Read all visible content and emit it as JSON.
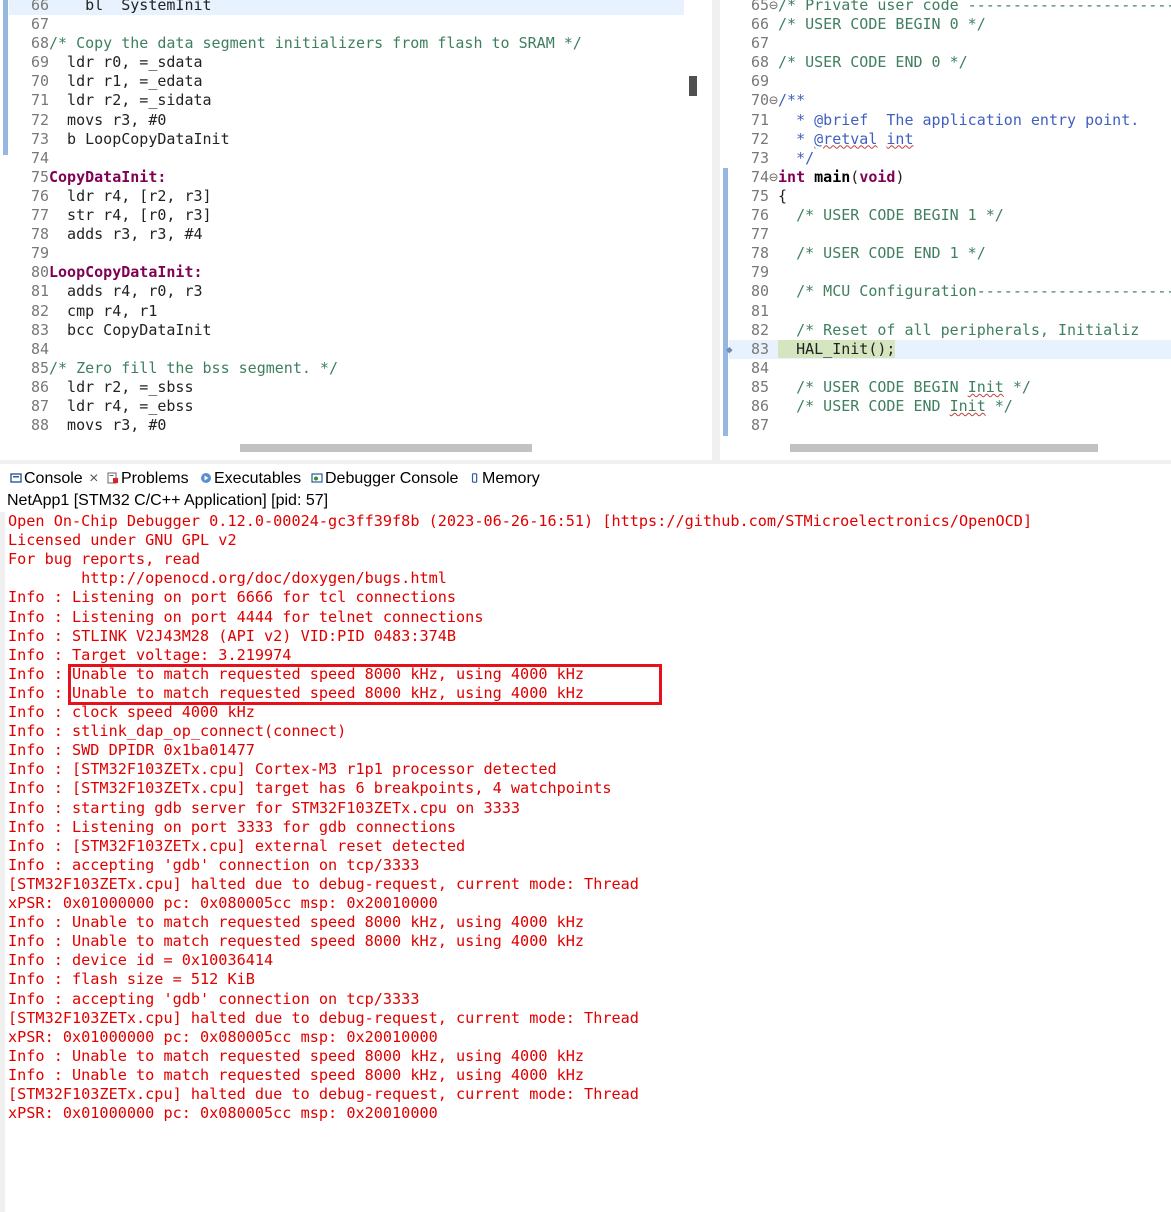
{
  "editor_left": {
    "lines": [
      {
        "n": "66",
        "code": "    bl  SystemInit"
      },
      {
        "n": "67",
        "code": ""
      },
      {
        "n": "68",
        "comment": "/* Copy the data segment initializers from flash to SRAM */"
      },
      {
        "n": "69",
        "code": "  ldr r0, =_sdata"
      },
      {
        "n": "70",
        "code": "  ldr r1, =_edata"
      },
      {
        "n": "71",
        "code": "  ldr r2, =_sidata"
      },
      {
        "n": "72",
        "code": "  movs r3, #0"
      },
      {
        "n": "73",
        "code": "  b LoopCopyDataInit"
      },
      {
        "n": "74",
        "code": ""
      },
      {
        "n": "75",
        "label": "CopyDataInit:"
      },
      {
        "n": "76",
        "code": "  ldr r4, [r2, r3]"
      },
      {
        "n": "77",
        "code": "  str r4, [r0, r3]"
      },
      {
        "n": "78",
        "code": "  adds r3, r3, #4"
      },
      {
        "n": "79",
        "code": ""
      },
      {
        "n": "80",
        "label": "LoopCopyDataInit:"
      },
      {
        "n": "81",
        "code": "  adds r4, r0, r3"
      },
      {
        "n": "82",
        "code": "  cmp r4, r1"
      },
      {
        "n": "83",
        "code": "  bcc CopyDataInit"
      },
      {
        "n": "84",
        "code": ""
      },
      {
        "n": "85",
        "comment": "/* Zero fill the bss segment. */"
      },
      {
        "n": "86",
        "code": "  ldr r2, =_sbss"
      },
      {
        "n": "87",
        "code": "  ldr r4, =_ebss"
      },
      {
        "n": "88",
        "code": "  movs r3, #0"
      }
    ]
  },
  "editor_right": {
    "l65": {
      "n": "65",
      "fold": "⊖",
      "comment": "/* Private user code -------------------------"
    },
    "l66": {
      "n": "66",
      "comment": "/* USER CODE BEGIN 0 */"
    },
    "l67": {
      "n": "67"
    },
    "l68": {
      "n": "68",
      "comment": "/* USER CODE END 0 */"
    },
    "l69": {
      "n": "69"
    },
    "l70": {
      "n": "70",
      "fold": "⊖",
      "comment": "/**"
    },
    "l71": {
      "n": "71",
      "pre": "  * ",
      "tag": "@brief",
      "rest": "  The application entry point."
    },
    "l72": {
      "n": "72",
      "pre": "  * ",
      "tag": "@retval",
      "sp": " ",
      "word": "int"
    },
    "l73": {
      "n": "73",
      "comment": "  */"
    },
    "l74": {
      "n": "74",
      "fold": "⊖",
      "kw1": "int",
      "name": "main",
      "paren_open": "(",
      "kw2": "void",
      "paren_close": ")"
    },
    "l75": {
      "n": "75",
      "code": "{"
    },
    "l76": {
      "n": "76",
      "comment": "  /* USER CODE BEGIN 1 */"
    },
    "l77": {
      "n": "77"
    },
    "l78": {
      "n": "78",
      "comment": "  /* USER CODE END 1 */"
    },
    "l79": {
      "n": "79"
    },
    "l80": {
      "n": "80",
      "comment": "  /* MCU Configuration--------------------------"
    },
    "l81": {
      "n": "81"
    },
    "l82": {
      "n": "82",
      "comment": "  /* Reset of all peripherals, Initializ"
    },
    "l83": {
      "n": "83",
      "code": "  HAL_Init();"
    },
    "l84": {
      "n": "84"
    },
    "l85": {
      "n": "85",
      "pre": "  /* USER CODE BEGIN ",
      "word": "Init",
      "post": " */"
    },
    "l86": {
      "n": "86",
      "pre": "  /* USER CODE END ",
      "word": "Init",
      "post": " */"
    },
    "l87": {
      "n": "87"
    }
  },
  "tabs": {
    "console": "Console",
    "close": "×",
    "problems": "Problems",
    "executables": "Executables",
    "debugger_console": "Debugger Console",
    "memory": "Memory"
  },
  "console": {
    "title": "NetApp1 [STM32 C/C++ Application]  [pid: 57]",
    "lines": [
      "Open On-Chip Debugger 0.12.0-00024-gc3ff39f8b (2023-06-26-16:51) [https://github.com/STMicroelectronics/OpenOCD]",
      "Licensed under GNU GPL v2",
      "For bug reports, read",
      "        http://openocd.org/doc/doxygen/bugs.html",
      "Info : Listening on port 6666 for tcl connections",
      "Info : Listening on port 4444 for telnet connections",
      "Info : STLINK V2J43M28 (API v2) VID:PID 0483:374B",
      "Info : Target voltage: 3.219974",
      "Info : Unable to match requested speed 8000 kHz, using 4000 kHz",
      "Info : Unable to match requested speed 8000 kHz, using 4000 kHz",
      "Info : clock speed 4000 kHz",
      "Info : stlink_dap_op_connect(connect)",
      "Info : SWD DPIDR 0x1ba01477",
      "Info : [STM32F103ZETx.cpu] Cortex-M3 r1p1 processor detected",
      "Info : [STM32F103ZETx.cpu] target has 6 breakpoints, 4 watchpoints",
      "Info : starting gdb server for STM32F103ZETx.cpu on 3333",
      "Info : Listening on port 3333 for gdb connections",
      "Info : [STM32F103ZETx.cpu] external reset detected",
      "Info : accepting 'gdb' connection on tcp/3333",
      "[STM32F103ZETx.cpu] halted due to debug-request, current mode: Thread",
      "xPSR: 0x01000000 pc: 0x080005cc msp: 0x20010000",
      "Info : Unable to match requested speed 8000 kHz, using 4000 kHz",
      "Info : Unable to match requested speed 8000 kHz, using 4000 kHz",
      "Info : device id = 0x10036414",
      "Info : flash size = 512 KiB",
      "Info : accepting 'gdb' connection on tcp/3333",
      "[STM32F103ZETx.cpu] halted due to debug-request, current mode: Thread",
      "xPSR: 0x01000000 pc: 0x080005cc msp: 0x20010000",
      "Info : Unable to match requested speed 8000 kHz, using 4000 kHz",
      "Info : Unable to match requested speed 8000 kHz, using 4000 kHz",
      "[STM32F103ZETx.cpu] halted due to debug-request, current mode: Thread",
      "xPSR: 0x01000000 pc: 0x080005cc msp: 0x20010000"
    ]
  },
  "colors": {
    "console_text": "#e00000",
    "highlight_box": "#e8101a",
    "comment": "#3f7f5f",
    "keyword": "#7f0055"
  }
}
